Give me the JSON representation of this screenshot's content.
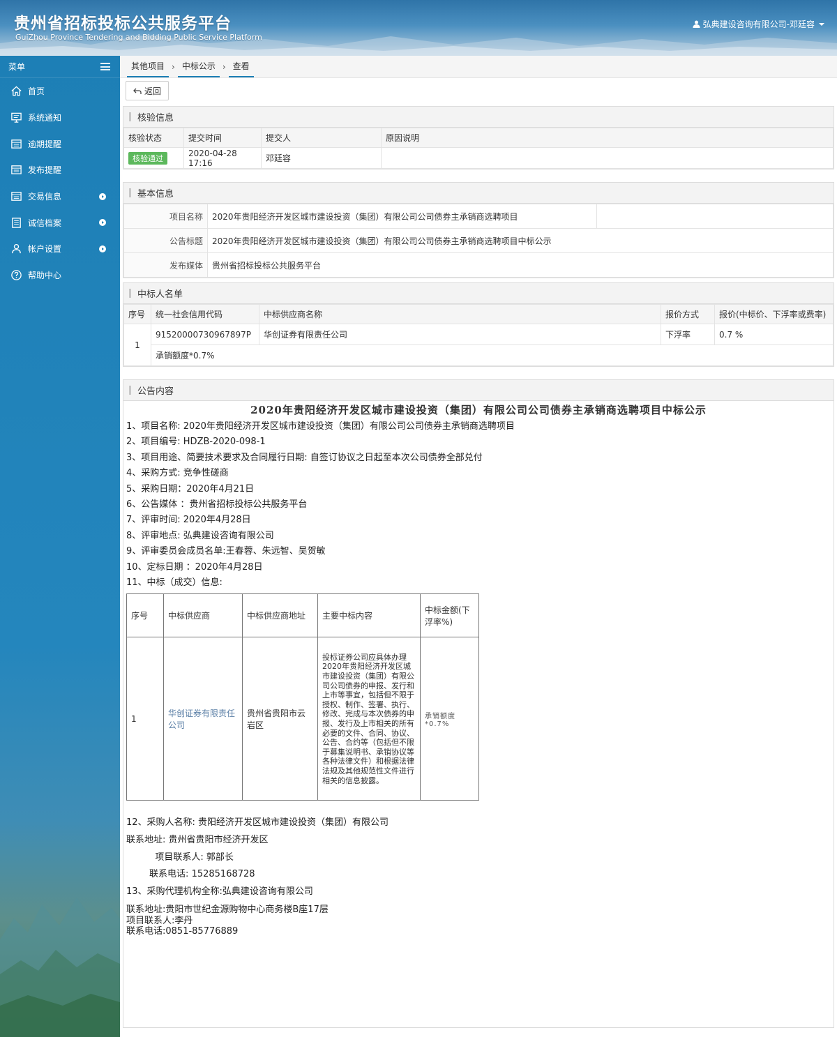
{
  "header": {
    "title": "贵州省招标投标公共服务平台",
    "subtitle": "GuiZhou Province Tendering and Bidding Public Service Platform",
    "user": "弘典建设咨询有限公司-邓廷容"
  },
  "sidebar": {
    "menu_label": "菜单",
    "items": [
      {
        "label": "首页",
        "icon": "home-icon",
        "has_sub": false
      },
      {
        "label": "系统通知",
        "icon": "monitor-icon",
        "has_sub": false
      },
      {
        "label": "逾期提醒",
        "icon": "list-icon",
        "has_sub": false
      },
      {
        "label": "发布提醒",
        "icon": "list-icon",
        "has_sub": false
      },
      {
        "label": "交易信息",
        "icon": "list-icon",
        "has_sub": true
      },
      {
        "label": "诚信档案",
        "icon": "document-icon",
        "has_sub": true
      },
      {
        "label": "帐户设置",
        "icon": "user-icon",
        "has_sub": true
      },
      {
        "label": "帮助中心",
        "icon": "help-icon",
        "has_sub": false
      }
    ]
  },
  "breadcrumb": [
    "其他项目",
    "中标公示",
    "查看"
  ],
  "toolbar": {
    "back_label": "返回"
  },
  "verify": {
    "title": "核验信息",
    "columns": [
      "核验状态",
      "提交时间",
      "提交人",
      "原因说明"
    ],
    "row": {
      "status": "核验通过",
      "time": "2020-04-28 17:16",
      "submitter": "邓廷容",
      "reason": ""
    }
  },
  "basic": {
    "title": "基本信息",
    "rows": [
      {
        "label": "项目名称",
        "value": "2020年贵阳经济开发区城市建设投资（集团）有限公司公司债券主承销商选聘项目"
      },
      {
        "label": "公告标题",
        "value": "2020年贵阳经济开发区城市建设投资（集团）有限公司公司债券主承销商选聘项目中标公示"
      },
      {
        "label": "发布媒体",
        "value": "贵州省招标投标公共服务平台"
      }
    ]
  },
  "winners": {
    "title": "中标人名单",
    "columns": [
      "序号",
      "统一社会信用代码",
      "中标供应商名称",
      "报价方式",
      "报价(中标价、下浮率或费率)"
    ],
    "row": {
      "no": "1",
      "code": "91520000730967897P",
      "name": "华创证券有限责任公司",
      "method": "下浮率",
      "price": "0.7 %",
      "note": "承销额度*0.7%"
    }
  },
  "notice": {
    "section_title": "公告内容",
    "title": "2020年贵阳经济开发区城市建设投资（集团）有限公司公司债券主承销商选聘项目中标公示",
    "lines": [
      "1、项目名称: 2020年贵阳经济开发区城市建设投资（集团）有限公司公司债券主承销商选聘项目",
      "2、项目编号: HDZB-2020-098-1",
      "3、项目用途、简要技术要求及合同履行日期: 自签订协议之日起至本次公司债券全部兑付",
      "4、采购方式: 竞争性磋商",
      "5、采购日期：2020年4月21日",
      "6、公告媒体 ：贵州省招标投标公共服务平台",
      "7、评审时间: 2020年4月28日",
      "8、评审地点: 弘典建设咨询有限公司",
      "9、评审委员会成员名单:王春蓉、朱远智、吴贺敏",
      "10、定标日期 ：2020年4月28日",
      "11、中标（成交）信息:"
    ],
    "award_table": {
      "headers": [
        "序号",
        "中标供应商",
        "中标供应商地址",
        "主要中标内容",
        "中标金额(下浮率%)"
      ],
      "row": {
        "no": "1",
        "supplier": "华创证券有限责任公司",
        "address": "贵州省贵阳市云岩区",
        "content": "投标证券公司应具体办理2020年贵阳经济开发区城市建设投资（集团）有限公司公司债券的申报、发行和上市等事宜，包括但不限于授权、制作、签署、执行、修改、完成与本次债券的申报、发行及上市相关的所有必要的文件、合同、协议、公告、合约等（包括但不限于募集说明书、承销协议等各种法律文件）和根据法律法规及其他规范性文件进行相关的信息披露。",
        "amount": "承销额度*0.7%"
      }
    },
    "after_lines": [
      "12、采购人名称: 贵阳经济开发区城市建设投资（集团）有限公司",
      "联系地址: 贵州省贵阳市经济开发区",
      "          项目联系人: 郭部长",
      "        联系电话: 15285168728",
      "13、采购代理机构全称:弘典建设咨询有限公司"
    ],
    "tail_lines": [
      "联系地址:贵阳市世纪金源购物中心商务楼B座17层",
      "项目联系人:李丹",
      "联系电话:0851-85776889"
    ]
  }
}
